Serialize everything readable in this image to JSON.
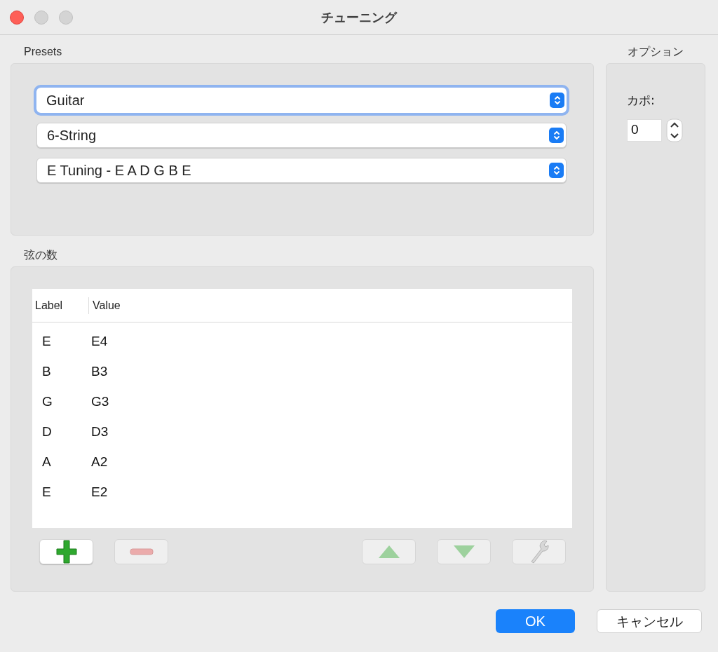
{
  "window": {
    "title": "チューニング"
  },
  "presets": {
    "label": "Presets",
    "dropdowns": [
      {
        "value": "Guitar",
        "focused": true
      },
      {
        "value": "6-String",
        "focused": false
      },
      {
        "value": "E Tuning - E A D G B E",
        "focused": false
      }
    ]
  },
  "strings": {
    "label": "弦の数",
    "table": {
      "columns": [
        "Label",
        "Value"
      ],
      "rows": [
        [
          "E",
          "E4"
        ],
        [
          "B",
          "B3"
        ],
        [
          "G",
          "G3"
        ],
        [
          "D",
          "D3"
        ],
        [
          "A",
          "A2"
        ],
        [
          "E",
          "E2"
        ]
      ]
    },
    "toolbar": [
      {
        "kind": "add",
        "disabled": false
      },
      {
        "kind": "remove",
        "disabled": true
      },
      {
        "kind": "up",
        "disabled": true
      },
      {
        "kind": "down",
        "disabled": true
      },
      {
        "kind": "edit",
        "disabled": true
      }
    ]
  },
  "options": {
    "label": "オプション",
    "capo_label": "カポ:",
    "capo_value": "0"
  },
  "buttons": {
    "ok": "OK",
    "cancel": "キャンセル"
  }
}
